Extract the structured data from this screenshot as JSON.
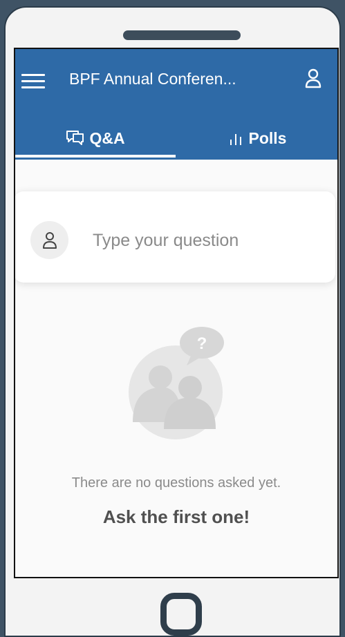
{
  "app": {
    "title": "BPF Annual Conferen..."
  },
  "tabs": [
    {
      "label": "Q&A",
      "icon": "chat-bubbles-icon",
      "active": true
    },
    {
      "label": "Polls",
      "icon": "bar-chart-icon",
      "active": false
    }
  ],
  "question_input": {
    "placeholder": "Type your question",
    "value": ""
  },
  "empty_state": {
    "message": "There are no questions asked yet.",
    "cta": "Ask the first one!"
  },
  "colors": {
    "app_bar": "#2e6aa7",
    "device_frame": "#3f5365",
    "device_body": "#f3f3f3"
  }
}
